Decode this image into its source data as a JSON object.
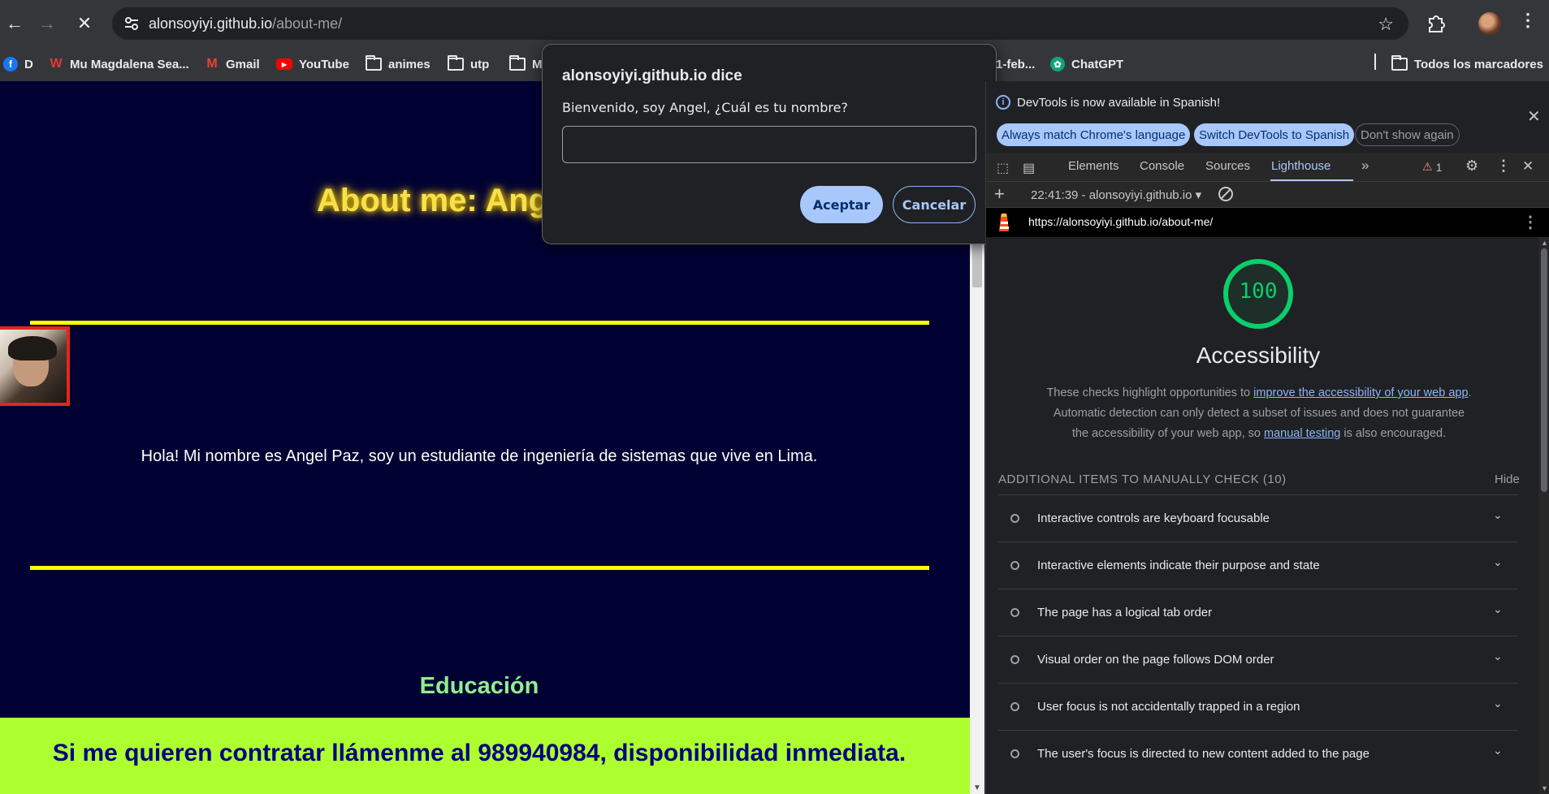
{
  "browser": {
    "url_host": "alonsoyiyi.github.io",
    "url_path": "/about-me/",
    "bookmarks": [
      {
        "label": "D",
        "icon": "facebook-icon",
        "color": "#1877f2"
      },
      {
        "label": "Mu Magdalena Sea...",
        "icon": "w-logo-icon",
        "color": "#e53935"
      },
      {
        "label": "Gmail",
        "icon": "gmail-icon",
        "color": "#ea4335"
      },
      {
        "label": "YouTube",
        "icon": "youtube-icon",
        "color": "#ff0000"
      },
      {
        "label": "animes",
        "icon": "folder-icon"
      },
      {
        "label": "utp",
        "icon": "folder-icon"
      },
      {
        "label": "M",
        "icon": "folder-icon"
      },
      {
        "label": "1-feb...",
        "icon": "none"
      },
      {
        "label": "ChatGPT",
        "icon": "chatgpt-icon",
        "color": "#10a37f"
      },
      {
        "label": "Todos los marcadores",
        "icon": "folder-icon"
      }
    ]
  },
  "page": {
    "title": "About me: Ang",
    "intro": "Hola! Mi nombre es Angel Paz, soy un estudiante de ingeniería de sistemas que vive en Lima.",
    "section_heading": "Educación",
    "footer": "Si me quieren contratar llámenme al 989940984, disponibilidad inmediata.",
    "colors": {
      "background": "#000033",
      "title": "#f7e04b",
      "rule": "#ffff00",
      "heading": "#90ee90",
      "footer_bg": "#adff2f",
      "footer_text": "#000080"
    }
  },
  "dialog": {
    "title": "alonsoyiyi.github.io dice",
    "message": "Bienvenido, soy Angel, ¿Cuál es tu nombre?",
    "input_value": "",
    "accept_label": "Aceptar",
    "cancel_label": "Cancelar"
  },
  "devtools": {
    "notice": "DevTools is now available in Spanish!",
    "notice_buttons": [
      "Always match Chrome's language",
      "Switch DevTools to Spanish",
      "Don't show again"
    ],
    "tabs": [
      "Elements",
      "Console",
      "Sources",
      "Lighthouse"
    ],
    "active_tab": "Lighthouse",
    "warning_count": "1",
    "report_select": "22:41:39 - alonsoyiyi.github.io",
    "report_url": "https://alonsoyiyi.github.io/about-me/",
    "score": "100",
    "category_title": "Accessibility",
    "desc_1": "These checks highlight opportunities to ",
    "desc_link_1": "improve the accessibility of your web app",
    "desc_2": ". Automatic detection can only detect a subset of issues and does not guarantee the accessibility of your web app, so ",
    "desc_link_2": "manual testing",
    "desc_3": " is also encouraged.",
    "manual_header": "ADDITIONAL ITEMS TO MANUALLY CHECK (10)",
    "hide_label": "Hide",
    "audits": [
      "Interactive controls are keyboard focusable",
      "Interactive elements indicate their purpose and state",
      "The page has a logical tab order",
      "Visual order on the page follows DOM order",
      "User focus is not accidentally trapped in a region",
      "The user's focus is directed to new content added to the page"
    ],
    "score_color": "#0cce6b"
  }
}
